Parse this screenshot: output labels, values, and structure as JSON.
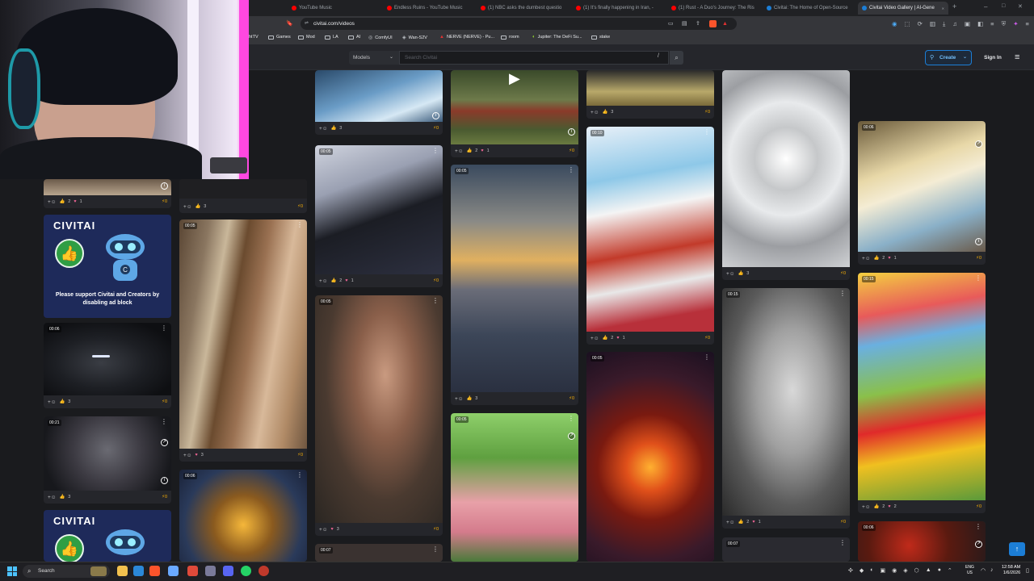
{
  "browser": {
    "tabs": [
      {
        "title": "YouTube Music",
        "color": "#ff0000",
        "active": false
      },
      {
        "title": "Endless Ruins - YouTube Music",
        "color": "#ff0000",
        "active": false
      },
      {
        "title": "(1) NBC asks the dumbest questio",
        "color": "#ff0000",
        "active": false
      },
      {
        "title": "(1) It's finally happening in Iran, -",
        "color": "#ff0000",
        "active": false
      },
      {
        "title": "(1) Rust - A Duo's Journey: The Ris",
        "color": "#ff0000",
        "active": false
      },
      {
        "title": "Civitai: The Home of Open-Source",
        "color": "#1c7ed6",
        "active": false
      },
      {
        "title": "Civitai Video Gallery | AI-Gene",
        "color": "#1c7ed6",
        "active": true
      }
    ],
    "new_tab": "+",
    "url": "civitai.com/videos",
    "bookmarks": [
      "htTV",
      "Games",
      "Mod",
      "LA",
      "AI",
      "ComfyUI",
      "Wan-S2V",
      "NERVE (NERVE) - Pu...",
      "room",
      "Jupiter: The DeFi Su...",
      "stake"
    ]
  },
  "header": {
    "model_select": "Models",
    "search_placeholder": "Search Civitai",
    "slash_key": "/",
    "create_label": "Create",
    "signin_label": "Sign In"
  },
  "ad": {
    "logo": "CIVITAI",
    "text": "Please support Civitai and Creators by disabling ad block"
  },
  "cards": [
    {
      "id": "c1",
      "dur": "",
      "likes": "2",
      "hearts": "1",
      "buzz": "0"
    },
    {
      "id": "c2",
      "dur": "",
      "likes": "3",
      "hearts": "",
      "buzz": "0"
    },
    {
      "id": "c3",
      "dur": "00:06",
      "likes": "3",
      "hearts": "",
      "buzz": "0"
    },
    {
      "id": "c4",
      "dur": "00:21",
      "likes": "3",
      "hearts": "",
      "buzz": "0"
    },
    {
      "id": "c5",
      "dur": "00:05",
      "likes": "",
      "hearts": "3",
      "buzz": "0"
    },
    {
      "id": "c6",
      "dur": "00:06",
      "likes": "",
      "hearts": "",
      "buzz": ""
    },
    {
      "id": "c7",
      "dur": "",
      "likes": "3",
      "hearts": "",
      "buzz": "0"
    },
    {
      "id": "c8",
      "dur": "00:05",
      "likes": "2",
      "hearts": "1",
      "buzz": "0"
    },
    {
      "id": "c9",
      "dur": "00:05",
      "likes": "",
      "hearts": "3",
      "buzz": "0"
    },
    {
      "id": "c10",
      "dur": "00:07",
      "likes": "",
      "hearts": "",
      "buzz": ""
    },
    {
      "id": "c11",
      "dur": "",
      "likes": "2",
      "hearts": "1",
      "buzz": "0"
    },
    {
      "id": "c12",
      "dur": "00:05",
      "likes": "3",
      "hearts": "",
      "buzz": "0"
    },
    {
      "id": "c13",
      "dur": "00:05",
      "likes": "",
      "hearts": "",
      "buzz": ""
    },
    {
      "id": "c14",
      "dur": "",
      "likes": "3",
      "hearts": "",
      "buzz": "0"
    },
    {
      "id": "c15",
      "dur": "00:10",
      "likes": "2",
      "hearts": "1",
      "buzz": "0"
    },
    {
      "id": "c16",
      "dur": "00:05",
      "likes": "",
      "hearts": "",
      "buzz": ""
    },
    {
      "id": "c17",
      "dur": "",
      "likes": "3",
      "hearts": "",
      "buzz": "0"
    },
    {
      "id": "c18",
      "dur": "00:15",
      "likes": "2",
      "hearts": "1",
      "buzz": "0"
    },
    {
      "id": "c19",
      "dur": "00:07",
      "likes": "",
      "hearts": "",
      "buzz": ""
    },
    {
      "id": "c20",
      "dur": "00:06",
      "likes": "2",
      "hearts": "1",
      "buzz": "0"
    },
    {
      "id": "c21",
      "dur": "00:15",
      "likes": "2",
      "hearts": "2",
      "buzz": "0"
    },
    {
      "id": "c22",
      "dur": "00:06",
      "likes": "",
      "hearts": "",
      "buzz": ""
    }
  ],
  "taskbar": {
    "search_label": "Search",
    "lang_top": "ENG",
    "lang_bottom": "US",
    "time": "12:58 AM",
    "date": "1/6/2026"
  },
  "colors": {
    "accent": "#1c7ed6",
    "like": "#fab005",
    "heart": "#f06595",
    "bg": "#1a1b1e",
    "card": "#25262b"
  }
}
